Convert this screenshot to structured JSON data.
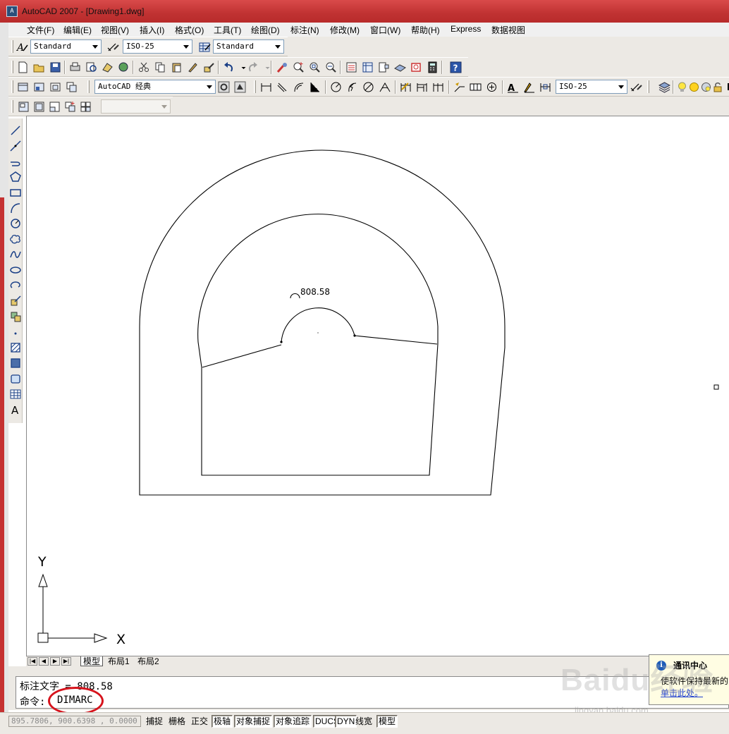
{
  "window": {
    "title": "AutoCAD 2007 - [Drawing1.dwg]",
    "app_icon_text": "A"
  },
  "menu": [
    "文件(F)",
    "编辑(E)",
    "视图(V)",
    "插入(I)",
    "格式(O)",
    "工具(T)",
    "绘图(D)",
    "标注(N)",
    "修改(M)",
    "窗口(W)",
    "帮助(H)",
    "Express",
    "数据视图"
  ],
  "styles_toolbar": {
    "text_style": "Standard",
    "dim_style": "ISO-25",
    "table_style": "Standard"
  },
  "workspace_toolbar": {
    "workspace": "AutoCAD 经典",
    "dim_style": "ISO-25"
  },
  "layer_toolbar": {
    "layer": ""
  },
  "drawing": {
    "dimension_text": "808.58",
    "ucs_y_label": "Y",
    "ucs_x_label": "X"
  },
  "layout_tabs": {
    "model": "模型",
    "layout1": "布局1",
    "layout2": "布局2"
  },
  "command": {
    "history_line": "标注文字 = 808.58",
    "prompt": "命令:",
    "input": "DIMARC"
  },
  "notification": {
    "title": "通讯中心",
    "body": "使软件保持最新的",
    "link": "单击此处。"
  },
  "status": {
    "coordinates": "895.7806, 900.6398 , 0.0000",
    "buttons": [
      {
        "label": "捕捉",
        "on": false
      },
      {
        "label": "栅格",
        "on": false
      },
      {
        "label": "正交",
        "on": false
      },
      {
        "label": "极轴",
        "on": true
      },
      {
        "label": "对象捕捉",
        "on": true
      },
      {
        "label": "对象追踪",
        "on": true
      },
      {
        "label": "DUCS",
        "on": true
      },
      {
        "label": "DYN",
        "on": true
      },
      {
        "label": "线宽",
        "on": false
      },
      {
        "label": "模型",
        "on": true
      }
    ]
  },
  "watermark": {
    "brand": "Baidu经验",
    "url": "jingyan.baidu.com"
  }
}
